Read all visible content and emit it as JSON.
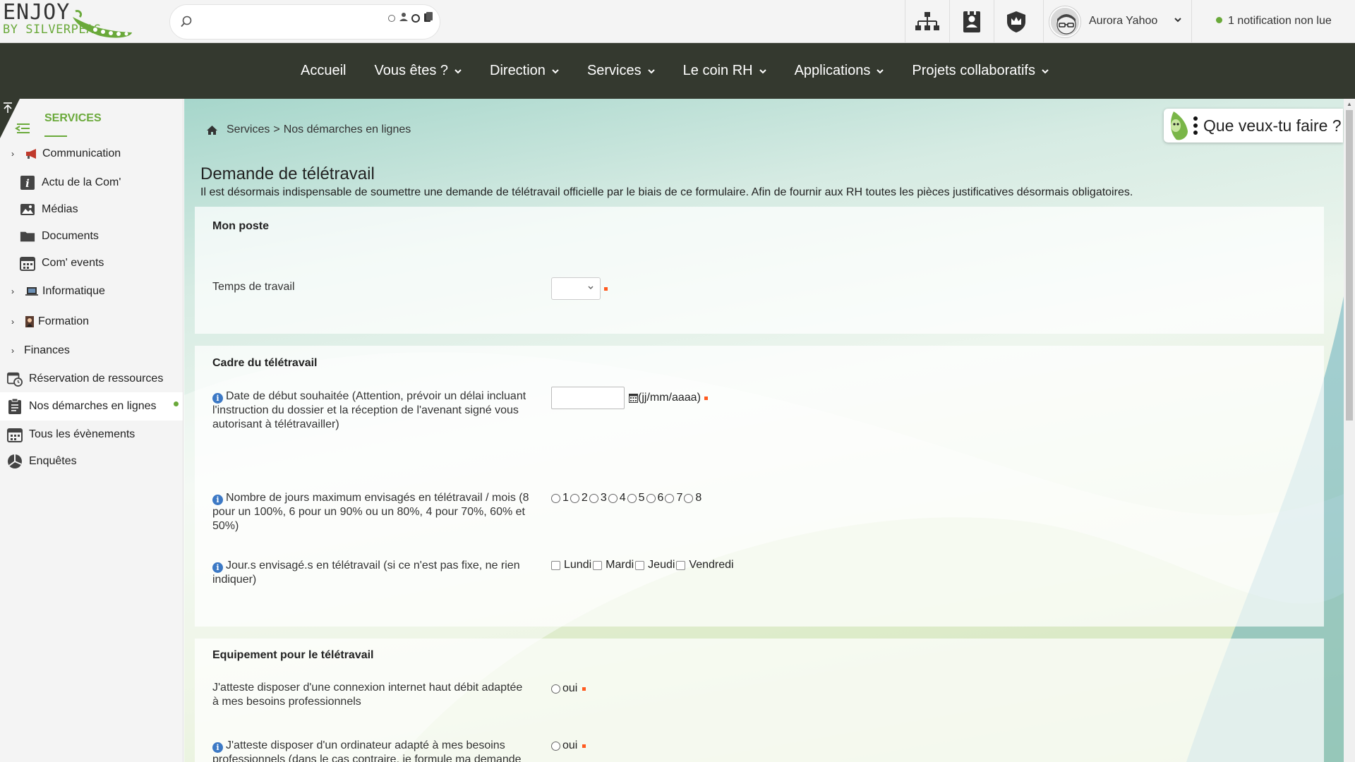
{
  "logo": {
    "line1": "ENJOY",
    "line2": "BY SILVERPEAS"
  },
  "search": {
    "value": "",
    "placeholder": ""
  },
  "header": {
    "user_name": "Aurora Yahoo",
    "notification": "1 notification non lue"
  },
  "nav": {
    "items": [
      {
        "label": "Accueil",
        "dropdown": false
      },
      {
        "label": "Vous êtes ?",
        "dropdown": true
      },
      {
        "label": "Direction",
        "dropdown": true
      },
      {
        "label": "Services",
        "dropdown": true
      },
      {
        "label": "Le coin RH",
        "dropdown": true
      },
      {
        "label": "Applications",
        "dropdown": true
      },
      {
        "label": "Projets collaboratifs",
        "dropdown": true
      }
    ]
  },
  "sidebar": {
    "title": "SERVICES",
    "items": [
      {
        "label": "Communication",
        "icon": "megaphone-icon"
      },
      {
        "label": "Actu de la Com'",
        "icon": "info-icon"
      },
      {
        "label": "Médias",
        "icon": "image-icon"
      },
      {
        "label": "Documents",
        "icon": "folder-icon"
      },
      {
        "label": "Com' events",
        "icon": "calendar-icon"
      },
      {
        "label": "Informatique",
        "icon": "laptop-icon"
      },
      {
        "label": "Formation",
        "icon": "teacher-icon"
      },
      {
        "label": "Finances",
        "icon": ""
      },
      {
        "label": "Réservation de ressources",
        "icon": "calendar-clock-icon"
      },
      {
        "label": "Nos démarches en lignes",
        "icon": "clipboard-icon",
        "active": true
      },
      {
        "label": "Tous les évènements",
        "icon": "calendar-icon"
      },
      {
        "label": "Enquêtes",
        "icon": "pie-chart-icon"
      }
    ]
  },
  "breadcrumb": {
    "section": "Services",
    "separator": ">",
    "page": "Nos démarches en lignes"
  },
  "assistant": {
    "label": "Que veux-tu faire ?"
  },
  "form": {
    "title": "Demande de télétravail",
    "description": "Il est désormais indispensable de soumettre une demande de télétravail officielle par le biais de ce formulaire. Afin de fournir aux RH toutes les pièces justificatives désormais obligatoires.",
    "section1": {
      "title": "Mon poste",
      "field_temps": "Temps de travail",
      "temps_value": ""
    },
    "section2": {
      "title": "Cadre du télétravail",
      "field_date": "Date de début souhaitée (Attention, prévoir un délai incluant l'instruction du dossier et la réception de l'avenant signé vous autorisant à télétravailler)",
      "date_value": "",
      "date_format": "(jj/mm/aaaa)",
      "field_jours": "Nombre de jours maximum envisagés en télétravail / mois (8 pour un 100%, 6 pour un 90% ou un 80%, 4 pour 70%, 60% et 50%)",
      "jours_options": [
        "1",
        "2",
        "3",
        "4",
        "5",
        "6",
        "7",
        "8"
      ],
      "field_days": "Jour.s envisagé.s en télétravail (si ce n'est pas fixe, ne rien indiquer)",
      "days_options": [
        "Lundi",
        "Mardi",
        "Jeudi",
        "Vendredi"
      ]
    },
    "section3": {
      "title": "Equipement pour le télétravail",
      "field_internet": "J'atteste disposer d'une connexion internet haut débit adaptée à mes besoins professionnels",
      "internet_option": "oui",
      "field_ordi": "J'atteste disposer d'un ordinateur adapté à mes besoins professionnels (dans le cas contraire, je formule ma demande",
      "ordi_option": "oui"
    }
  },
  "colors": {
    "accent_green": "#6aa93a",
    "nav_bg": "#34392f",
    "required": "#ff5a1f",
    "info_blue": "#3c79c5"
  }
}
